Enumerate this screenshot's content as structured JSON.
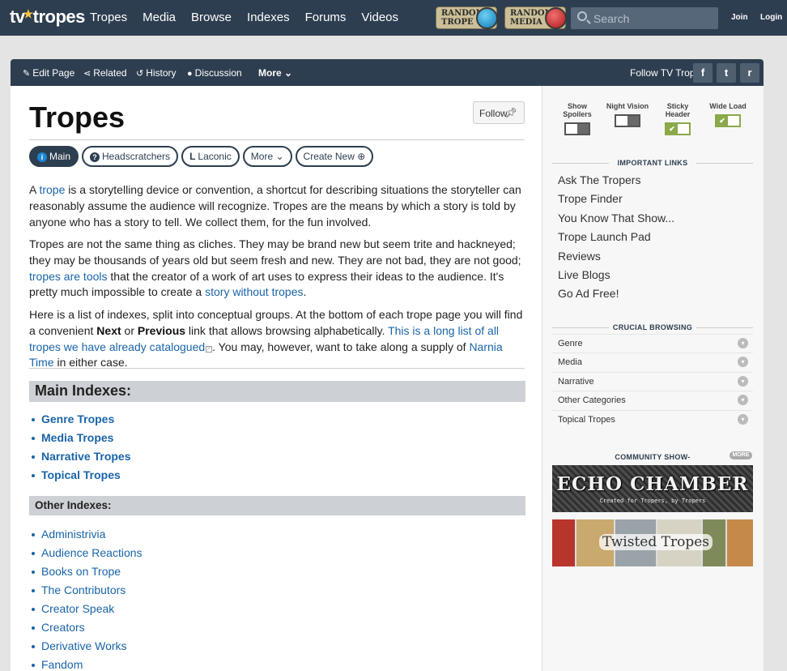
{
  "site": {
    "logo": "tv tropes",
    "nav": [
      "Tropes",
      "Media",
      "Browse",
      "Indexes",
      "Forums",
      "Videos"
    ],
    "random_trope": "RANDOM TROPE",
    "random_media": "RANDOM MEDIA",
    "search_placeholder": "Search",
    "join": "Join",
    "login": "Login"
  },
  "actions": {
    "edit": "Edit Page",
    "related": "Related",
    "history": "History",
    "discussion": "Discussion",
    "more": "More",
    "follow_tv": "Follow TV Tropes",
    "social": [
      "f",
      "t",
      "r"
    ]
  },
  "page": {
    "title": "Tropes",
    "follow": "Follow",
    "tabs": [
      "Main",
      "Headscratchers",
      "Laconic",
      "More",
      "Create New"
    ],
    "p1": {
      "a": "A ",
      "link": "trope",
      "b": " is a storytelling device or convention, a shortcut for describing situations the storyteller can reasonably assume the audience will recognize. Tropes are the means by which a story is told by anyone who has a story to tell. We collect them, for the fun involved."
    },
    "p2": {
      "a": "Tropes are not the same thing as cliches. They may be brand new but seem trite and hackneyed; they may be thousands of years old but seem fresh and new. They are not bad, they are not good; ",
      "link1": "tropes are tools",
      "b": " that the creator of a work of art uses to express their ideas to the audience. It's pretty much impossible to create a ",
      "link2": "story without tropes",
      "c": "."
    },
    "p3": {
      "a": "Here is a list of indexes, split into conceptual groups. At the bottom of each trope page you will find a convenient ",
      "next": "Next",
      "or": " or ",
      "prev": "Previous",
      "b": " link that allows browsing alphabetically. ",
      "link1": "This is a long list of all tropes we have already catalogued",
      "c": ". You may, however, want to take along a supply of ",
      "link2": "Narnia Time",
      "d": " in either case."
    },
    "main_indexes_title": "Main Indexes:",
    "main_indexes": [
      "Genre Tropes",
      "Media Tropes",
      "Narrative Tropes",
      "Topical Tropes"
    ],
    "other_indexes_title": "Other Indexes:",
    "other_indexes": [
      "Administrivia",
      "Audience Reactions",
      "Books on Trope",
      "The Contributors",
      "Creator Speak",
      "Creators",
      "Derivative Works",
      "Fandom"
    ]
  },
  "sidebar": {
    "toggles": [
      {
        "label": "Show Spoilers",
        "on": false
      },
      {
        "label": "Night Vision",
        "on": false
      },
      {
        "label": "Sticky Header",
        "on": true
      },
      {
        "label": "Wide Load",
        "on": true
      }
    ],
    "important_title": "IMPORTANT LINKS",
    "important": [
      "Ask The Tropers",
      "Trope Finder",
      "You Know That Show...",
      "Trope Launch Pad",
      "Reviews",
      "Live Blogs",
      "Go Ad Free!"
    ],
    "crucial_title": "CRUCIAL BROWSING",
    "crucial": [
      "Genre",
      "Media",
      "Narrative",
      "Other Categories",
      "Topical Tropes"
    ],
    "community_title": "COMMUNITY SHOW-",
    "more_badge": "MORE",
    "echo_title": "ECHO CHAMBER",
    "echo_sub": "Created for Tropers, by Tropers",
    "twisted_title": "Twisted Tropes"
  },
  "colors": {
    "nav_bg": "#2d3e50",
    "link": "#1a64a8",
    "toggle_on": "#8aa94a"
  }
}
